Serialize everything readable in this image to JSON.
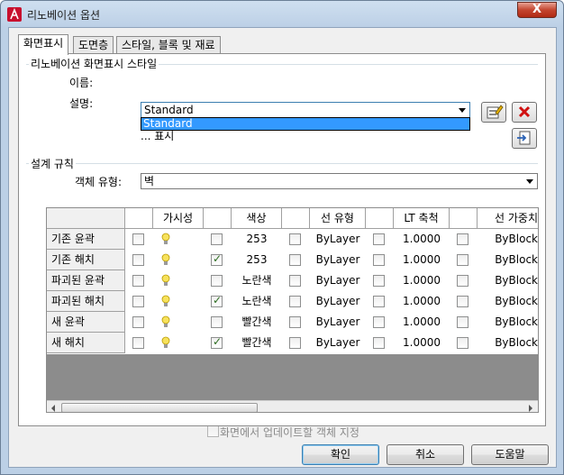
{
  "window": {
    "title": "리노베이션 옵션",
    "close_symbol": "X"
  },
  "tabs": [
    {
      "label": "화면표시",
      "active": true
    },
    {
      "label": "도면층",
      "active": false
    },
    {
      "label": "스타일, 블록 및 재료",
      "active": false
    }
  ],
  "display_style": {
    "group_label": "리노베이션 화면표시 스타일",
    "name_label": "이름:",
    "name_value": "Standard",
    "dropdown_option": "Standard",
    "desc_label": "설명:",
    "desc_text": "... 표시",
    "icons": {
      "edit": "edit-style-icon",
      "delete": "delete-style-icon",
      "import": "import-style-icon"
    }
  },
  "design_rules": {
    "group_label": "설계 규칙",
    "object_type_label": "객체 유형:",
    "object_type_value": "벽"
  },
  "grid": {
    "columns": [
      "가시성",
      "색상",
      "선 유형",
      "LT 축척",
      "선 가중치"
    ],
    "rows": [
      {
        "name": "기존 윤곽",
        "vis_cb": false,
        "color_cb": false,
        "color": "253",
        "lt_cb": false,
        "linetype": "ByLayer",
        "lts_cb": false,
        "ltscale": "1.0000",
        "lw_cb": false,
        "lineweight": "ByBlock"
      },
      {
        "name": "기존 해치",
        "vis_cb": false,
        "color_cb": true,
        "color": "253",
        "lt_cb": false,
        "linetype": "ByLayer",
        "lts_cb": false,
        "ltscale": "1.0000",
        "lw_cb": false,
        "lineweight": "ByBlock"
      },
      {
        "name": "파괴된 윤곽",
        "vis_cb": false,
        "color_cb": false,
        "color": "노란색",
        "lt_cb": false,
        "linetype": "ByLayer",
        "lts_cb": false,
        "ltscale": "1.0000",
        "lw_cb": false,
        "lineweight": "ByBlock"
      },
      {
        "name": "파괴된 해치",
        "vis_cb": false,
        "color_cb": true,
        "color": "노란색",
        "lt_cb": false,
        "linetype": "ByLayer",
        "lts_cb": false,
        "ltscale": "1.0000",
        "lw_cb": false,
        "lineweight": "ByBlock"
      },
      {
        "name": "새 윤곽",
        "vis_cb": false,
        "color_cb": false,
        "color": "빨간색",
        "lt_cb": false,
        "linetype": "ByLayer",
        "lts_cb": false,
        "ltscale": "1.0000",
        "lw_cb": false,
        "lineweight": "ByBlock"
      },
      {
        "name": "새 해치",
        "vis_cb": false,
        "color_cb": true,
        "color": "빨간색",
        "lt_cb": false,
        "linetype": "ByLayer",
        "lts_cb": false,
        "ltscale": "1.0000",
        "lw_cb": false,
        "lineweight": "ByBlock"
      }
    ]
  },
  "update_checkbox": {
    "label": "화면에서 업데이트할 객체 지정",
    "enabled": false
  },
  "buttons": {
    "ok": "확인",
    "cancel": "취소",
    "help": "도움말"
  },
  "colors": {
    "window_frame": "#bcd0e6",
    "selection": "#3399ff",
    "close": "#c4452f",
    "grid_empty": "#8c8c8c"
  }
}
